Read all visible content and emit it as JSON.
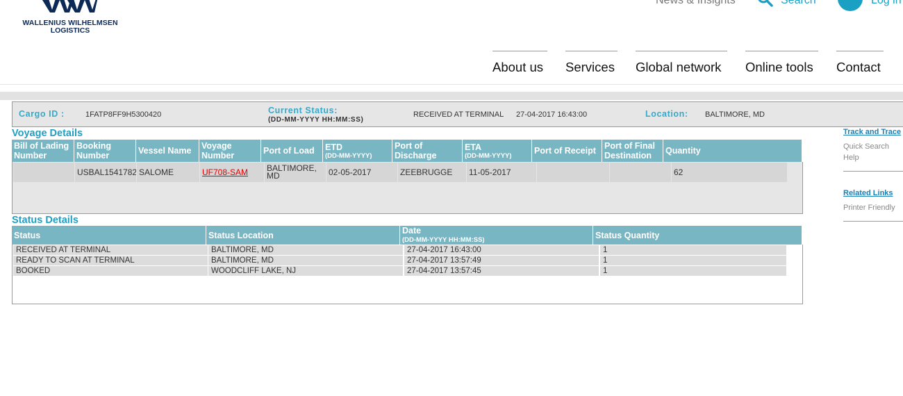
{
  "brand": {
    "name_line1": "WALLENIUS WILHELMSEN",
    "name_line2": "LOGISTICS",
    "color": "#0d2a57"
  },
  "utility_nav": {
    "news": "News & Insights",
    "search": "Search",
    "login": "Log in",
    "accent": "#1aa0c3"
  },
  "main_nav": [
    "About us",
    "Services",
    "Global network",
    "Online tools",
    "Contact"
  ],
  "cargo": {
    "id_label": "Cargo ID :",
    "id_value": "1FATP8FF9H5300420",
    "status_label": "Current Status:",
    "status_format": "(DD-MM-YYYY HH:MM:SS)",
    "status_value": "RECEIVED AT TERMINAL",
    "status_time": "27-04-2017 16:43:00",
    "location_label": "Location:",
    "location_value": "BALTIMORE, MD"
  },
  "voyage": {
    "title": "Voyage  Details",
    "headers": [
      {
        "l1": "Bill of Lading",
        "l2": "Number",
        "small": false
      },
      {
        "l1": "Booking",
        "l2": "Number",
        "small": false
      },
      {
        "l1": "Vessel  Name",
        "l2": "",
        "small": false
      },
      {
        "l1": "Voyage",
        "l2": "Number",
        "small": false
      },
      {
        "l1": "Port of Load",
        "l2": "",
        "small": false
      },
      {
        "l1": "ETD",
        "l2": "(DD-MM-YYYY)",
        "small": true
      },
      {
        "l1": "Port of",
        "l2": "Discharge",
        "small": false
      },
      {
        "l1": "ETA",
        "l2": "(DD-MM-YYYY)",
        "small": true
      },
      {
        "l1": "Port of  Receipt",
        "l2": "",
        "small": false
      },
      {
        "l1": "Port of Final",
        "l2": "Destination",
        "small": false
      },
      {
        "l1": "Quantity",
        "l2": "",
        "small": false
      }
    ],
    "row": {
      "bill_of_lading": "",
      "booking": "USBAL1541782",
      "vessel": "SALOME",
      "voyage": "UF708-SAM",
      "port_load_l1": "BALTIMORE,",
      "port_load_l2": "MD",
      "etd": "02-05-2017",
      "port_discharge": "ZEEBRUGGE",
      "eta": "11-05-2017",
      "port_receipt": "",
      "final_destination": "",
      "quantity": "62"
    }
  },
  "status": {
    "title": "Status Details",
    "headers": {
      "status": "Status",
      "location": "Status Location",
      "date": "Date",
      "date_format": "(DD-MM-YYYY HH:MM:SS)",
      "quantity": "Status Quantity"
    },
    "rows": [
      {
        "status": "RECEIVED AT TERMINAL",
        "location": "BALTIMORE, MD",
        "date": "27-04-2017 16:43:00",
        "qty": "1"
      },
      {
        "status": "READY TO SCAN AT TERMINAL",
        "location": "BALTIMORE, MD",
        "date": "27-04-2017 13:57:49",
        "qty": "1"
      },
      {
        "status": "BOOKED",
        "location": "WOODCLIFF LAKE, NJ",
        "date": "27-04-2017 13:57:45",
        "qty": "1"
      }
    ]
  },
  "sidebar": {
    "track_trace": "Track and Trace",
    "quick_search": "Quick Search",
    "help": "Help",
    "related_links": "Related Links",
    "printer_friendly": "Printer Friendly"
  },
  "colors": {
    "table_header": "#79b6c3",
    "label_teal": "#33aacc",
    "link_red": "#e30000"
  }
}
